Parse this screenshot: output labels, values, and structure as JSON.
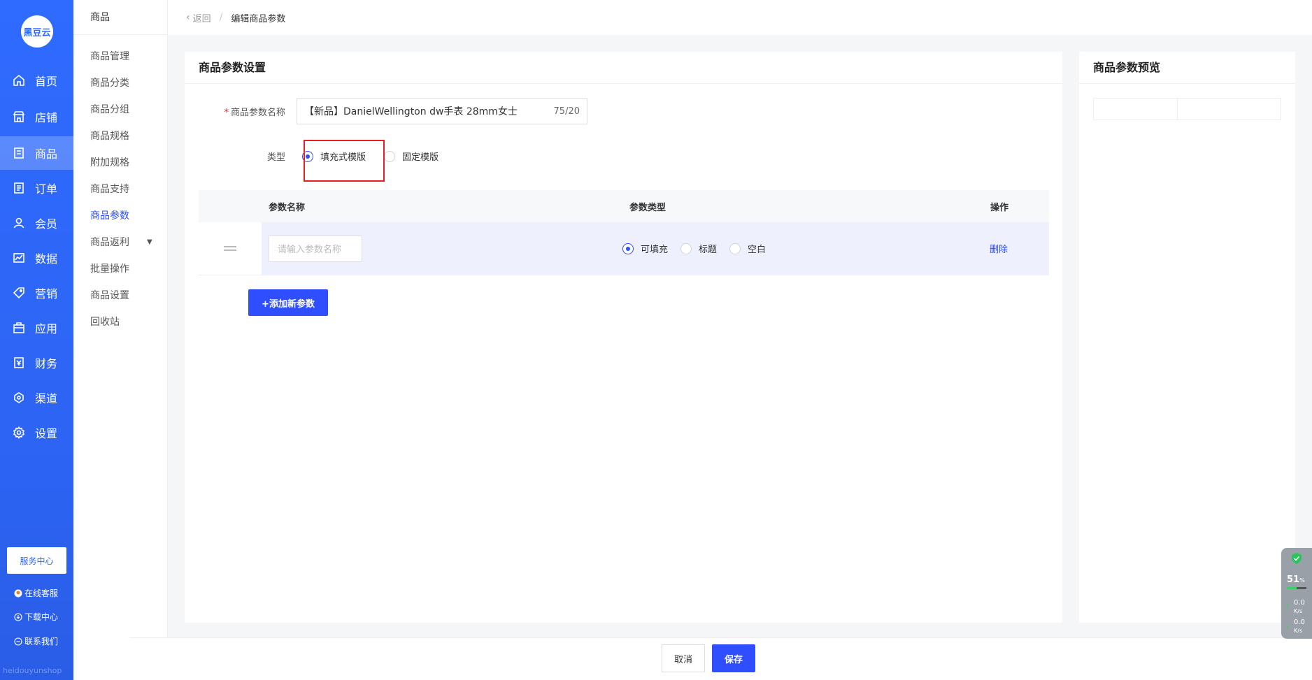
{
  "nav": {
    "logo_text": "黑豆云",
    "items": [
      {
        "label": "首页",
        "icon": "home-icon"
      },
      {
        "label": "店铺",
        "icon": "shop-icon"
      },
      {
        "label": "商品",
        "icon": "goods-icon",
        "active": true
      },
      {
        "label": "订单",
        "icon": "order-icon"
      },
      {
        "label": "会员",
        "icon": "member-icon"
      },
      {
        "label": "数据",
        "icon": "data-icon"
      },
      {
        "label": "营销",
        "icon": "tag-icon"
      },
      {
        "label": "应用",
        "icon": "app-icon"
      },
      {
        "label": "财务",
        "icon": "finance-icon"
      },
      {
        "label": "渠道",
        "icon": "channel-icon"
      },
      {
        "label": "设置",
        "icon": "gear-icon"
      }
    ],
    "service_center": "服务中心",
    "online_service": "在线客服",
    "download_center": "下载中心",
    "contact_us": "联系我们",
    "domain": "heidouyunshop"
  },
  "subnav": {
    "title": "商品",
    "items": [
      {
        "label": "商品管理"
      },
      {
        "label": "商品分类"
      },
      {
        "label": "商品分组"
      },
      {
        "label": "商品规格"
      },
      {
        "label": "附加规格"
      },
      {
        "label": "商品支持"
      },
      {
        "label": "商品参数",
        "active": true
      },
      {
        "label": "商品返利",
        "has_caret": true
      },
      {
        "label": "批量操作"
      },
      {
        "label": "商品设置"
      },
      {
        "label": "回收站"
      }
    ]
  },
  "breadcrumb": {
    "back": "返回",
    "separator": "/",
    "current": "编辑商品参数"
  },
  "form": {
    "card_title": "商品参数设置",
    "name_label": "商品参数名称",
    "name_value": "【新品】DanielWellington dw手表 28mm女士",
    "name_count": "75/20",
    "type_label": "类型",
    "type_options": [
      "填充式模版",
      "固定模版"
    ],
    "type_selected": "填充式模版"
  },
  "param_table": {
    "headers": [
      "参数名称",
      "参数类型",
      "操作"
    ],
    "rows": [
      {
        "name_placeholder": "请输入参数名称",
        "type_options": [
          "可填充",
          "标题",
          "空白"
        ],
        "type_selected": "可填充",
        "action": "删除"
      }
    ],
    "add_button": "+添加新参数"
  },
  "preview": {
    "title": "商品参数预览"
  },
  "footer": {
    "cancel": "取消",
    "save": "保存"
  },
  "widget": {
    "percent": "51",
    "percent_unit": "%",
    "up_speed": "0.0",
    "down_speed": "0.0",
    "speed_unit": "K/s"
  },
  "colors": {
    "primary": "#2f4eff",
    "nav_blue": "#2f6bff",
    "highlight_red": "#e81e25"
  }
}
